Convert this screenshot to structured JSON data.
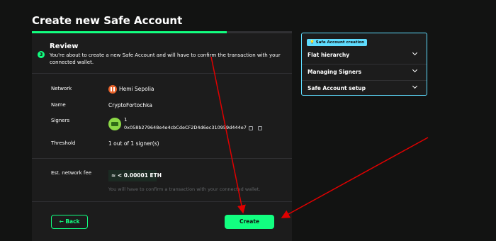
{
  "page": {
    "title": "Create new Safe Account"
  },
  "review": {
    "step_number": "3",
    "title": "Review",
    "description": "You're about to create a new Safe Account and will have to confirm the transaction with your connected wallet."
  },
  "details": {
    "network_label": "Network",
    "network_value": "Hemi Sepolia",
    "name_label": "Name",
    "name_value": "CryptoFortochka",
    "signers_label": "Signers",
    "signer_count": "1",
    "signer_address": "0x058b279648e4e4cbCdeCF2D4d6ec310959d444e7",
    "threshold_label": "Threshold",
    "threshold_value": "1 out of 1 signer(s)"
  },
  "fee": {
    "label": "Est. network fee",
    "value": "≈ < 0.00001 ETH",
    "note": "You will have to confirm a transaction with your connected wallet."
  },
  "buttons": {
    "back": "← Back",
    "create": "Create"
  },
  "sidebar": {
    "badge": "💡 Safe Account creation",
    "items": [
      {
        "label": "Flat hierarchy"
      },
      {
        "label": "Managing Signers"
      },
      {
        "label": "Safe Account setup"
      }
    ]
  },
  "colors": {
    "accent": "#12ff80",
    "info": "#5fddff",
    "annotation": "#e00000",
    "background": "#121312",
    "card": "#1c1c1c"
  },
  "icons": [
    "network-logo-icon",
    "identicon-avatar",
    "copy-icon",
    "external-link-icon",
    "lightbulb-icon",
    "chevron-down-icon"
  ],
  "progress": {
    "fraction": 0.75
  }
}
